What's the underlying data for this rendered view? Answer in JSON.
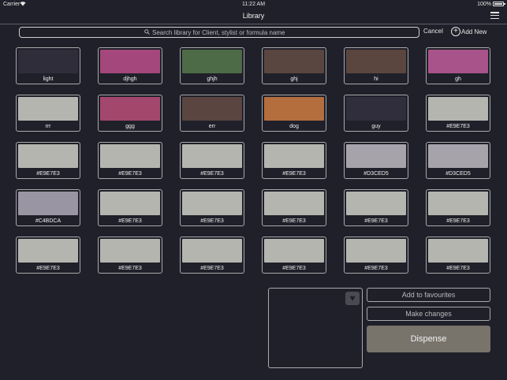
{
  "status_bar": {
    "carrier": "Carrier",
    "time": "11:22 AM",
    "battery": "100%"
  },
  "nav": {
    "title": "Library"
  },
  "search": {
    "placeholder": "Search library for Client, stylist or formula name",
    "value": ""
  },
  "actions": {
    "cancel": "Cancel",
    "add_new": "Add New"
  },
  "swatches": [
    {
      "label": "light",
      "color": "#2f2d3a"
    },
    {
      "label": "djhgh",
      "color": "#a3477c"
    },
    {
      "label": "ghjh",
      "color": "#4d6b47"
    },
    {
      "label": "ghj",
      "color": "#5a4640"
    },
    {
      "label": "hi",
      "color": "#5a463f"
    },
    {
      "label": "gh",
      "color": "#a8538a"
    },
    {
      "label": "rrr",
      "color": "#b5b5b0"
    },
    {
      "label": "ggg",
      "color": "#a4476c"
    },
    {
      "label": "err",
      "color": "#5a4540"
    },
    {
      "label": "dog",
      "color": "#b46e3e"
    },
    {
      "label": "guy",
      "color": "#302d3c"
    },
    {
      "label": "#E9E7E3",
      "color": "#b5b5b0"
    },
    {
      "label": "#E9E7E3",
      "color": "#b5b5b0"
    },
    {
      "label": "#E9E7E3",
      "color": "#b5b5b0"
    },
    {
      "label": "#E9E7E3",
      "color": "#b5b5b0"
    },
    {
      "label": "#E9E7E3",
      "color": "#b5b5b0"
    },
    {
      "label": "#D3CED5",
      "color": "#a6a3aa"
    },
    {
      "label": "#D3CED5",
      "color": "#a6a3aa"
    },
    {
      "label": "#C4BDCA",
      "color": "#9a95a2"
    },
    {
      "label": "#E9E7E3",
      "color": "#b5b5b0"
    },
    {
      "label": "#E9E7E3",
      "color": "#b5b5b0"
    },
    {
      "label": "#E9E7E3",
      "color": "#b5b5b0"
    },
    {
      "label": "#E9E7E3",
      "color": "#b5b5b0"
    },
    {
      "label": "#E9E7E3",
      "color": "#b5b5b0"
    },
    {
      "label": "#E9E7E3",
      "color": "#b5b5b0"
    },
    {
      "label": "#E9E7E3",
      "color": "#b5b5b0"
    },
    {
      "label": "#E9E7E3",
      "color": "#b5b5b0"
    },
    {
      "label": "#E9E7E3",
      "color": "#b5b5b0"
    },
    {
      "label": "#E9E7E3",
      "color": "#b5b5b0"
    },
    {
      "label": "#E9E7E3",
      "color": "#b5b5b0"
    }
  ],
  "detail": {
    "add_to_favourites": "Add to favourites",
    "make_changes": "Make changes",
    "dispense": "Dispense",
    "favourite_icon": "heart-icon"
  },
  "colors": {
    "background": "#1f2029",
    "dispense_button": "#78746c"
  }
}
